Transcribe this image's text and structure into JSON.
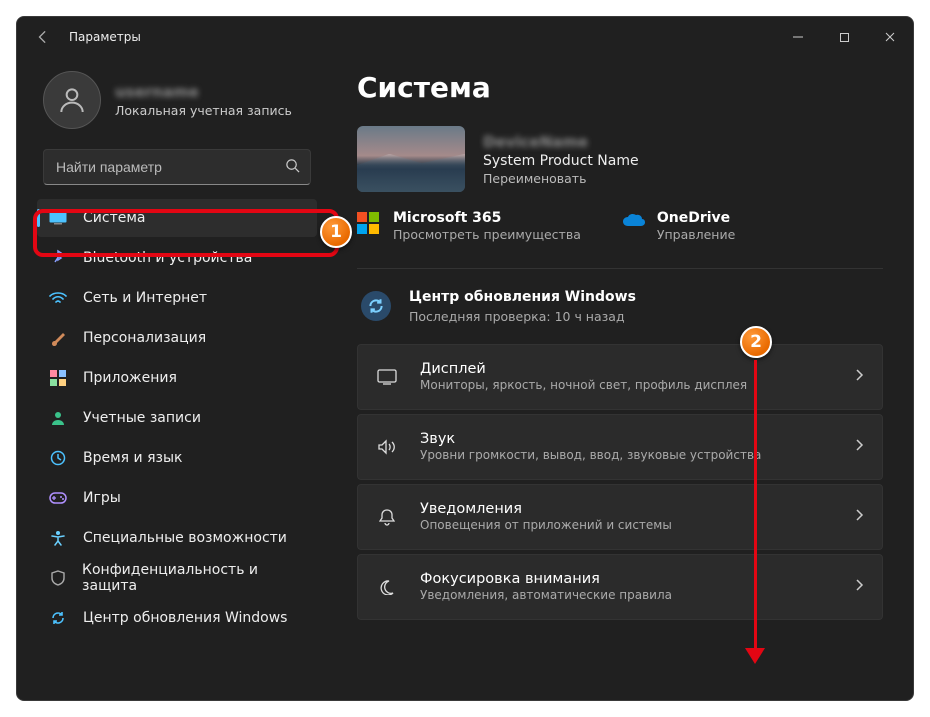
{
  "window": {
    "title": "Параметры"
  },
  "profile": {
    "username": "username",
    "type": "Локальная учетная запись"
  },
  "search": {
    "placeholder": "Найти параметр"
  },
  "sidebar": {
    "items": [
      {
        "label": "Система"
      },
      {
        "label": "Bluetooth и устройства"
      },
      {
        "label": "Сеть и Интернет"
      },
      {
        "label": "Персонализация"
      },
      {
        "label": "Приложения"
      },
      {
        "label": "Учетные записи"
      },
      {
        "label": "Время и язык"
      },
      {
        "label": "Игры"
      },
      {
        "label": "Специальные возможности"
      },
      {
        "label": "Конфиденциальность и защита"
      },
      {
        "label": "Центр обновления Windows"
      }
    ]
  },
  "page": {
    "header": "Система",
    "device": {
      "name": "DeviceName",
      "product": "System Product Name",
      "rename": "Переименовать"
    },
    "promos": {
      "ms365": {
        "title": "Microsoft 365",
        "sub": "Просмотреть преимущества"
      },
      "onedrive": {
        "title": "OneDrive",
        "sub": "Управление"
      }
    },
    "update": {
      "title": "Центр обновления Windows",
      "sub": "Последняя проверка: 10 ч назад"
    },
    "settings": [
      {
        "title": "Дисплей",
        "sub": "Мониторы, яркость, ночной свет, профиль дисплея"
      },
      {
        "title": "Звук",
        "sub": "Уровни громкости, вывод, ввод, звуковые устройства"
      },
      {
        "title": "Уведомления",
        "sub": "Оповещения от приложений и системы"
      },
      {
        "title": "Фокусировка внимания",
        "sub": "Уведомления, автоматические правила"
      }
    ]
  },
  "markers": {
    "one": "1",
    "two": "2"
  }
}
